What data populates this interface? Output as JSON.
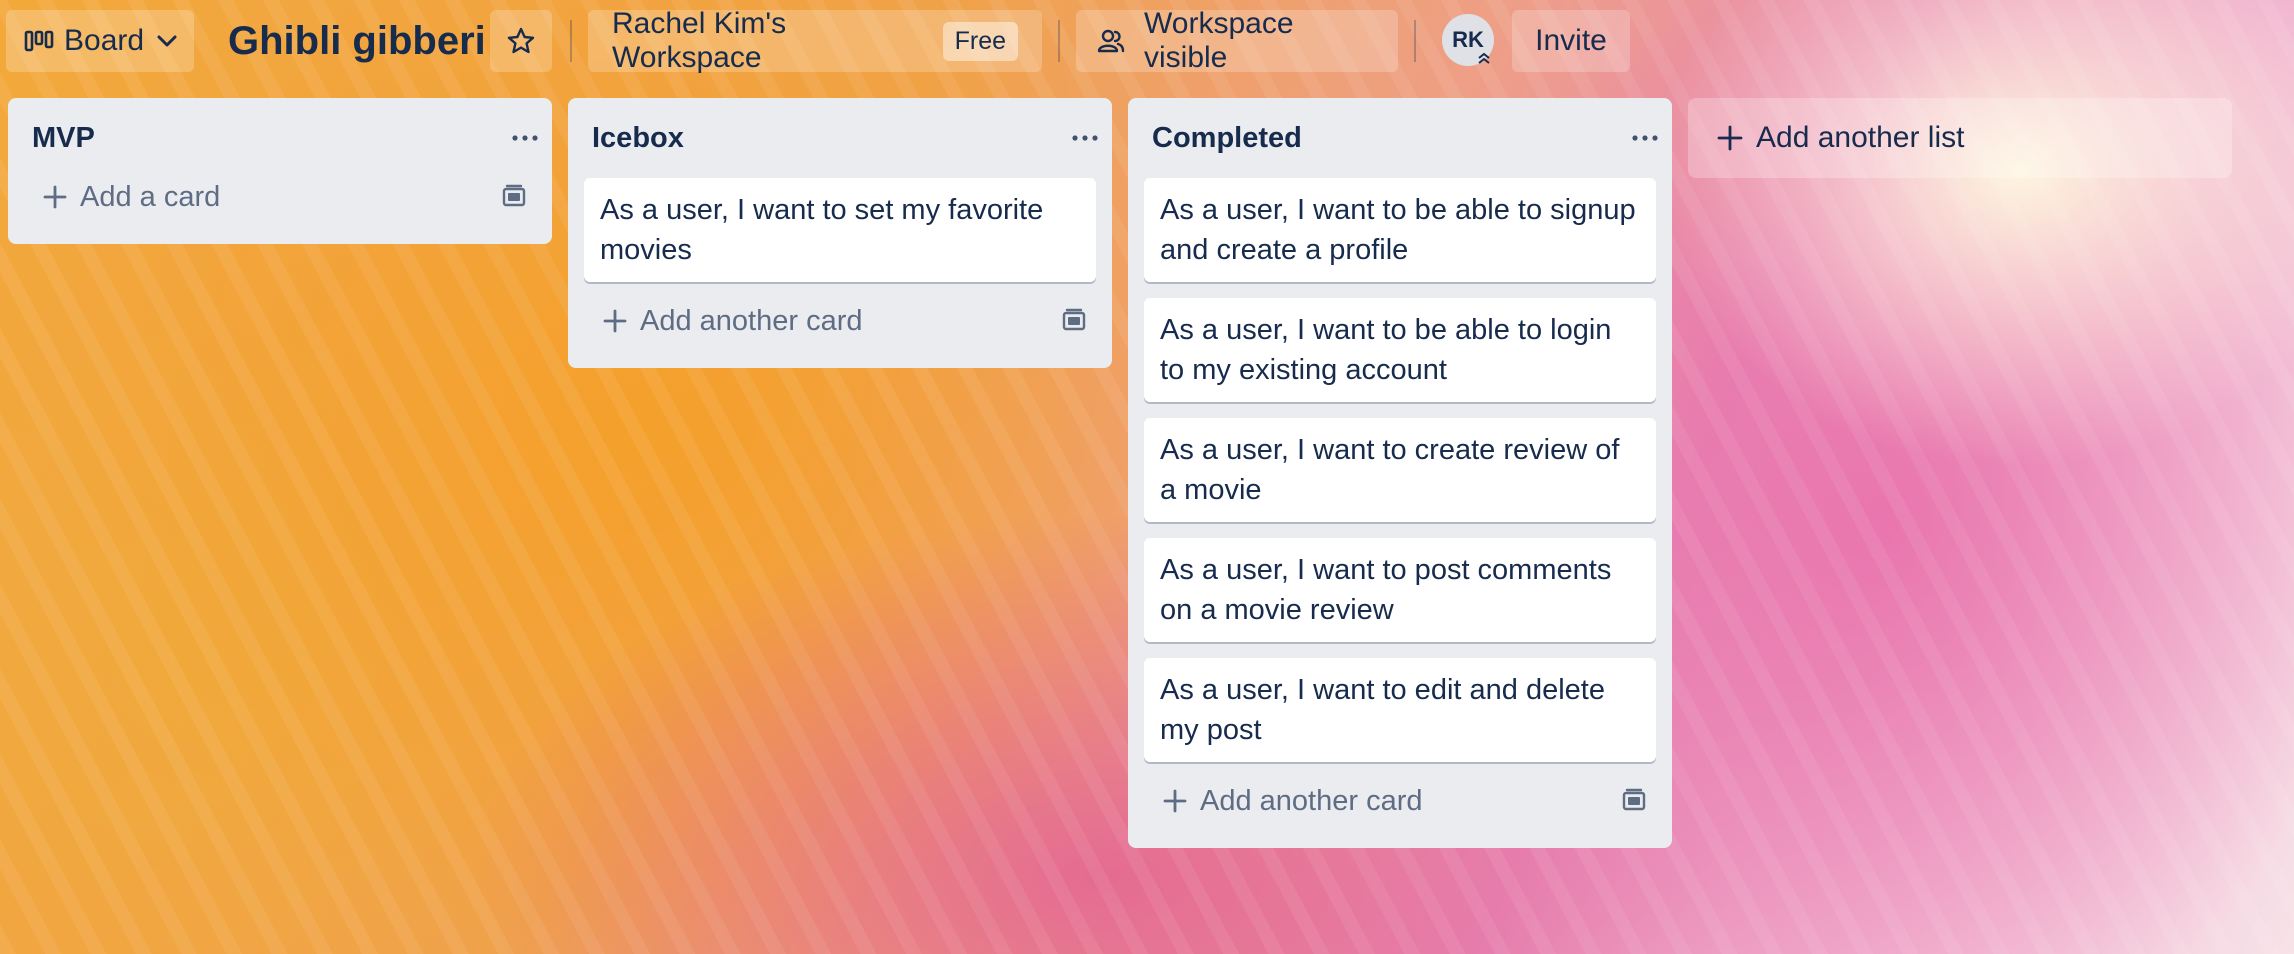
{
  "header": {
    "view_label": "Board",
    "board_title": "Ghibli gibberi",
    "workspace_name": "Rachel Kim's Workspace",
    "plan_badge": "Free",
    "visibility_label": "Workspace visible",
    "avatar_initials": "RK",
    "invite_label": "Invite"
  },
  "lists": [
    {
      "title": "MVP",
      "cards": [],
      "add_label": "Add a card"
    },
    {
      "title": "Icebox",
      "cards": [
        "As a user, I want to set my favorite movies"
      ],
      "add_label": "Add another card"
    },
    {
      "title": "Completed",
      "cards": [
        "As a user, I want to be able to signup and create a profile",
        "As a user, I want to be able to login to my existing account",
        "As a user, I want to create review of a movie",
        "As a user, I want to post comments on a movie review",
        "As a user, I want to edit and delete my post"
      ],
      "add_label": "Add another card"
    }
  ],
  "add_list_label": "Add another list",
  "icons": {
    "view": "board-icon",
    "dropdown": "chevron-down-icon",
    "star": "star-icon",
    "visibility": "people-icon",
    "list_menu": "more-horizontal-icon",
    "add": "plus-icon",
    "template": "card-template-icon"
  },
  "colors": {
    "list_bg": "#ebecf0",
    "text": "#172b4d",
    "muted": "#5e6c84"
  }
}
